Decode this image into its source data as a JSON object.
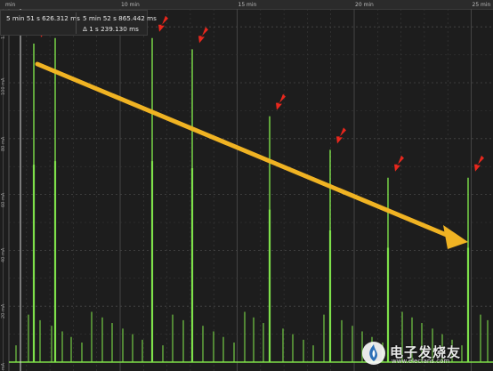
{
  "colors": {
    "background": "#1d1d1d",
    "grid": "#3b3b3b",
    "signal": "#7ee04a",
    "arrow_markers": "#e8271d",
    "trend_arrow": "#f0b323",
    "cursor_line": "#d9d9d9"
  },
  "timeline": {
    "ticks": [
      {
        "label": "min",
        "minutes": 0
      },
      {
        "label": "10 min",
        "minutes": 10
      },
      {
        "label": "15 min",
        "minutes": 15
      },
      {
        "label": "20 min",
        "minutes": 20
      },
      {
        "label": "25 min",
        "minutes": 25
      }
    ]
  },
  "y_axis": {
    "labels": [
      "120 mA",
      "100 mA",
      "80 mA",
      "60 mA",
      "40 mA",
      "20 mA",
      "0 mA"
    ]
  },
  "measurement": {
    "cursor_a": "5 min 51 s 626.312 ms",
    "cursor_b": "5 min 52 s 865.442 ms",
    "delta": "Δ 1 s 239.130 ms"
  },
  "chart_data": {
    "type": "line",
    "title": "",
    "xlabel": "",
    "ylabel": "",
    "ylim": [
      0,
      130
    ],
    "series": [
      {
        "tall_spikes_mA": [
          114,
          116,
          116,
          112,
          88,
          76,
          66,
          66
        ],
        "small_spike_mA_range": [
          5,
          20
        ]
      }
    ],
    "annotations": [
      "red markers point at each tall spike",
      "orange arrow shows decreasing spike amplitude over time"
    ]
  },
  "watermark": {
    "text": "电子发烧友",
    "url": "www.elecfans.com",
    "icon": "elecfans-logo-icon"
  }
}
